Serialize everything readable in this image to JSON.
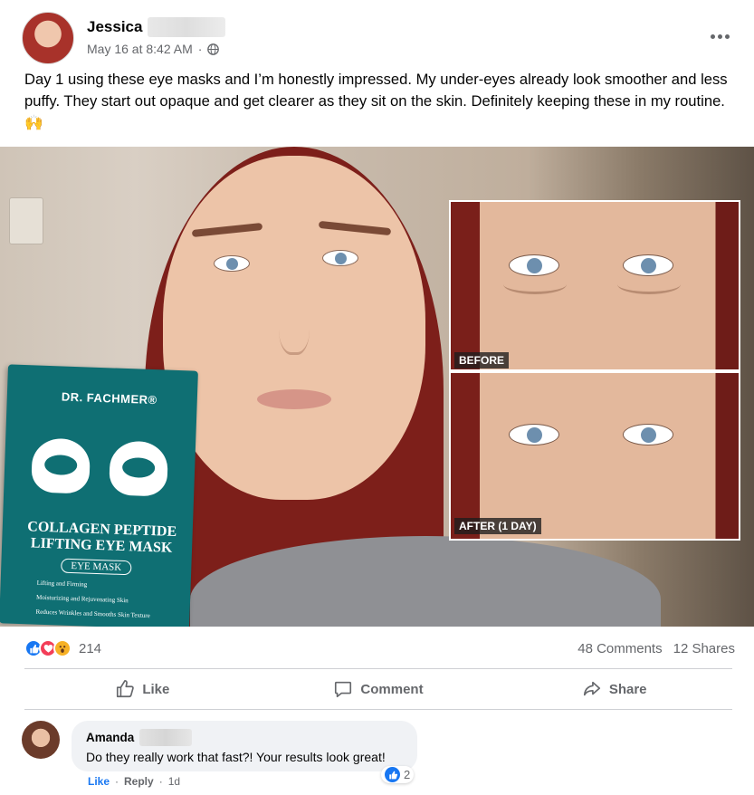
{
  "post": {
    "author_name": "Jessica",
    "timestamp": "May 16 at 8:42 AM",
    "separator": "·",
    "privacy_icon": "globe-icon",
    "more_icon": "more-options-icon",
    "text": "Day 1 using these eye masks and I’m honestly impressed. My under-eyes already look smoother and less puffy. They start out opaque and get clearer as they sit on the skin. Definitely keeping these in my routine. 🙌"
  },
  "photo": {
    "product_brand": "DR. FACHMER®",
    "product_title": "COLLAGEN PEPTIDE LIFTING EYE MASK",
    "product_subtitle": "EYE MASK",
    "product_features": [
      "Lifting and Firming",
      "Moisturizing and Rejuvenating Skin",
      "Reduces Wrinkles and Smooths Skin Texture"
    ],
    "before_label": "BEFORE",
    "after_label": "AFTER (1 DAY)"
  },
  "stats": {
    "reaction_count": "214",
    "comments": "48 Comments",
    "shares": "12 Shares"
  },
  "actions": {
    "like": "Like",
    "comment": "Comment",
    "share": "Share"
  },
  "comment": {
    "author_name": "Amanda",
    "text": "Do they really work that fast?! Your results look great!",
    "like_label": "Like",
    "reply_label": "Reply",
    "separator": "·",
    "age": "1d",
    "reaction_count": "2"
  },
  "colors": {
    "accent": "#1877f2",
    "love": "#f33e58",
    "wow": "#f7b125",
    "muted_text": "#65676b",
    "box_teal": "#0f6f73"
  }
}
